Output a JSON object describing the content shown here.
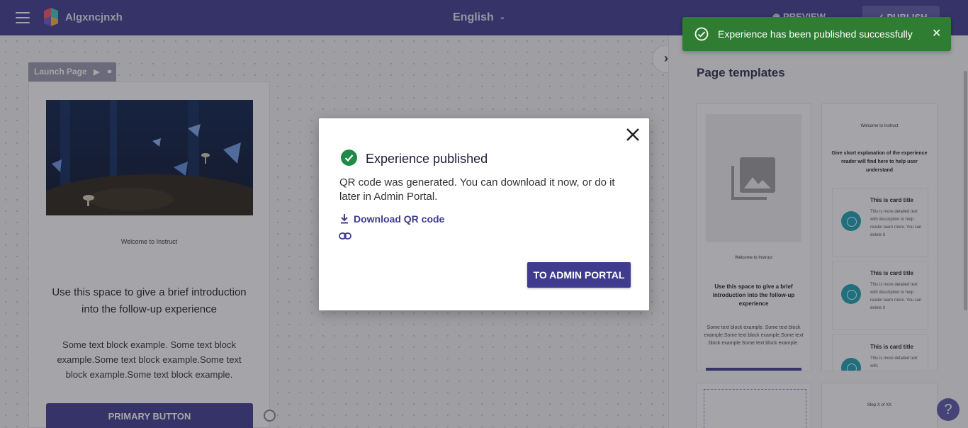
{
  "header": {
    "app_title": "Algxncjnxh",
    "language": "English",
    "preview_label": "PREVIEW",
    "publish_label": "PUBLISH"
  },
  "canvas": {
    "launch_tag": "Launch Page",
    "welcome_small": "Welcome to Instruct",
    "intro_text": "Use this space to give a brief introduction into the follow-up experience",
    "text_block": "Some text block example. Some text block example.Some text block example.Some text block example.Some text block example.",
    "primary_button": "PRIMARY BUTTON"
  },
  "panel": {
    "title": "Page templates",
    "template1": {
      "welcome": "Welcome to Instruct",
      "intro": "Use this space to give a brief introduction into the follow-up experience",
      "text": "Some text block example. Some text block example.Some text block example.Some text block example.Some text block example."
    },
    "template2": {
      "welcome": "Welcome to Instruct",
      "subtitle": "Give short explanation of the experience reader will find here to help user understand",
      "cards": [
        {
          "title": "This is card title",
          "text": "This is more detailed text with description to help reader learn more. You can delete it"
        },
        {
          "title": "This is card title",
          "text": "This is more detailed text with description to help reader learn more. You can delete it"
        },
        {
          "title": "This is card title",
          "text": "This is more detailed text with"
        }
      ]
    },
    "template4": {
      "step": "Step X of XX"
    }
  },
  "modal": {
    "title": "Experience published",
    "body": "QR code was generated. You can download it now, or do it later in Admin Portal.",
    "download_label": "Download QR code",
    "admin_button": "TO ADMIN PORTAL"
  },
  "toast": {
    "message": "Experience has been published successfully"
  },
  "colors": {
    "brand": "#3f3c8f",
    "success": "#2e7d32",
    "teal": "#1aa2b4"
  }
}
